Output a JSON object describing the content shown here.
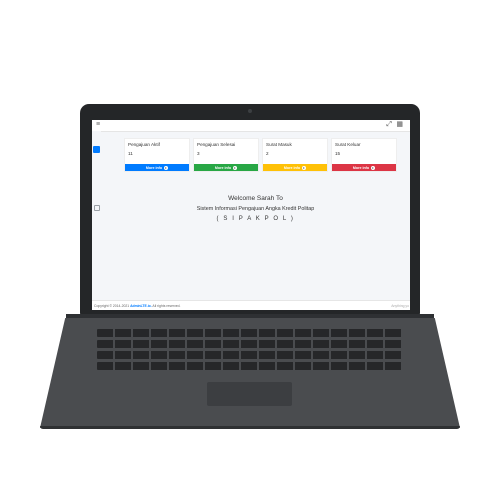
{
  "topbar": {
    "menu_icon": "hamburger-icon",
    "expand_icon": "expand-icon",
    "grid_icon": "grid-icon"
  },
  "stats": [
    {
      "label": "Pengajuan Aktif",
      "count": "11",
      "more": "More info",
      "color": "#007bff"
    },
    {
      "label": "Pengajuan Selesai",
      "count": "3",
      "more": "More info",
      "color": "#28a745"
    },
    {
      "label": "Surat Masuk",
      "count": "2",
      "more": "More info",
      "color": "#ffc107"
    },
    {
      "label": "Surat Keluar",
      "count": "15",
      "more": "More info",
      "color": "#dc3545"
    }
  ],
  "welcome": {
    "line1": "Welcome Sarah To",
    "line2": "Sistem Informasi Pengajuan Angka Kredit Politap",
    "line3": "( S I P A K P O L )"
  },
  "footer": {
    "copyright_prefix": "Copyright © 2014-2021 ",
    "brand": "AdminLTE.io.",
    "suffix": " All rights reserved.",
    "right": "Anything yo"
  },
  "colors": {
    "active_nav": "#007bff",
    "laptop_body": "#242628",
    "laptop_base": "#4a4c4f"
  }
}
